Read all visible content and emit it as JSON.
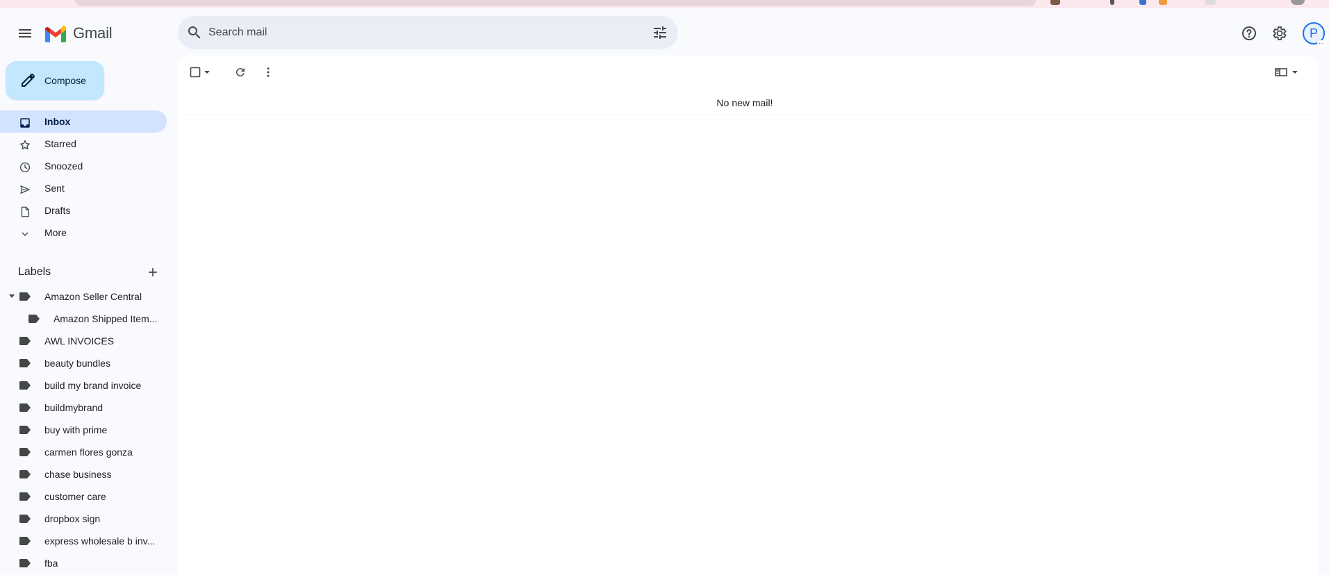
{
  "app": {
    "name": "Gmail"
  },
  "colors": {
    "accent": "#1a73e8",
    "compose_bg": "#c2e7ff",
    "active_nav_bg": "#d3e3fd",
    "logo_red": "#ea4335",
    "logo_blue": "#4285f4",
    "logo_green": "#34a853",
    "logo_yellow": "#fbbc04"
  },
  "header": {
    "menu_icon": "hamburger-menu-icon",
    "search_placeholder": "Search mail",
    "search_icon": "search-icon",
    "filter_icon": "search-options-icon",
    "help_icon": "help-icon",
    "settings_icon": "gear-icon",
    "avatar_letter": "P"
  },
  "sidebar": {
    "compose_label": "Compose",
    "nav": [
      {
        "label": "Inbox",
        "icon": "inbox-icon",
        "active": true
      },
      {
        "label": "Starred",
        "icon": "star-icon",
        "active": false
      },
      {
        "label": "Snoozed",
        "icon": "clock-icon",
        "active": false
      },
      {
        "label": "Sent",
        "icon": "send-icon",
        "active": false
      },
      {
        "label": "Drafts",
        "icon": "draft-icon",
        "active": false
      },
      {
        "label": "More",
        "icon": "chevron-down-icon",
        "active": false
      }
    ],
    "labels_heading": "Labels",
    "labels": [
      {
        "label": "Amazon Seller Central",
        "expanded": true
      },
      {
        "label": "Amazon Shipped Item...",
        "child": true
      },
      {
        "label": "AWL INVOICES"
      },
      {
        "label": "beauty bundles"
      },
      {
        "label": "build my brand invoice"
      },
      {
        "label": "buildmybrand"
      },
      {
        "label": "buy with prime"
      },
      {
        "label": "carmen flores gonza"
      },
      {
        "label": "chase business"
      },
      {
        "label": "customer care"
      },
      {
        "label": "dropbox sign"
      },
      {
        "label": "express wholesale b inv..."
      },
      {
        "label": "fba"
      }
    ]
  },
  "main": {
    "toolbar": {
      "select_icon": "checkbox-icon",
      "select_dropdown_icon": "caret-down-icon",
      "refresh_icon": "refresh-icon",
      "more_icon": "more-vertical-icon",
      "split_pane_icon": "split-pane-icon"
    },
    "empty_message": "No new mail!"
  }
}
